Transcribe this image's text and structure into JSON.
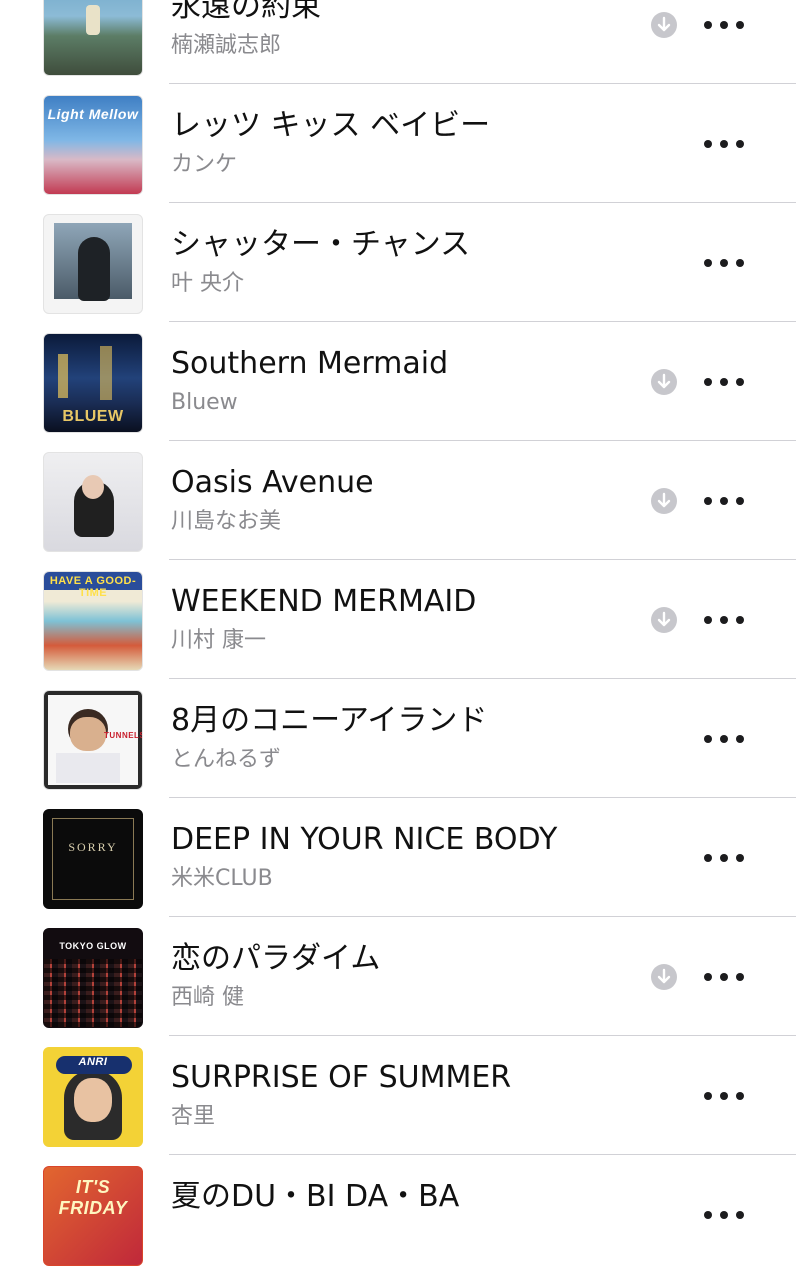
{
  "songs": [
    {
      "title": "永遠の約束",
      "artist": "楠瀬誠志郎",
      "downloaded": true,
      "art": "sea-cliff-cover"
    },
    {
      "title": "レッツ キッス ベイビー",
      "artist": "カンケ",
      "downloaded": false,
      "art": "light-mellow-cover"
    },
    {
      "title": "シャッター・チャンス",
      "artist": "叶 央介",
      "downloaded": false,
      "art": "silhouette-cover"
    },
    {
      "title": "Southern Mermaid",
      "artist": "Bluew",
      "downloaded": true,
      "art": "city-night-cover"
    },
    {
      "title": "Oasis Avenue",
      "artist": "川島なお美",
      "downloaded": true,
      "art": "portrait-cover"
    },
    {
      "title": "WEEKEND MERMAID",
      "artist": "川村 康一",
      "downloaded": true,
      "art": "have-a-good-time-cover"
    },
    {
      "title": "8月のコニーアイランド",
      "artist": "とんねるず",
      "downloaded": false,
      "art": "tunnels-cover"
    },
    {
      "title": "DEEP IN YOUR NICE BODY",
      "artist": "米米CLUB",
      "downloaded": false,
      "art": "sorry-cover"
    },
    {
      "title": "恋のパラダイム",
      "artist": "西崎 健",
      "downloaded": true,
      "art": "tokyo-glow-cover"
    },
    {
      "title": "SURPRISE OF SUMMER",
      "artist": "杏里",
      "downloaded": false,
      "art": "anri-cover"
    },
    {
      "title": "夏のDU・BI DA・BA",
      "artist": "",
      "downloaded": false,
      "art": "its-friday-cover"
    }
  ],
  "covers": {
    "light_mellow": "Light Mellow",
    "bluew": "BLUEW",
    "have_a_good_time": "HAVE A GOOD-TIME",
    "tunnels": "TUNNELS",
    "sorry": "SORRY",
    "tokyo_glow": "TOKYO GLOW",
    "anri": "ANRI",
    "its_friday": "IT'S FRIDAY"
  },
  "icons": {
    "download": "download-circle-icon",
    "more": "more-ellipsis-icon"
  },
  "colors": {
    "title": "#111111",
    "artist": "#8a8a8e",
    "separator": "#d1d1d6",
    "download": "#c7c7cc"
  }
}
